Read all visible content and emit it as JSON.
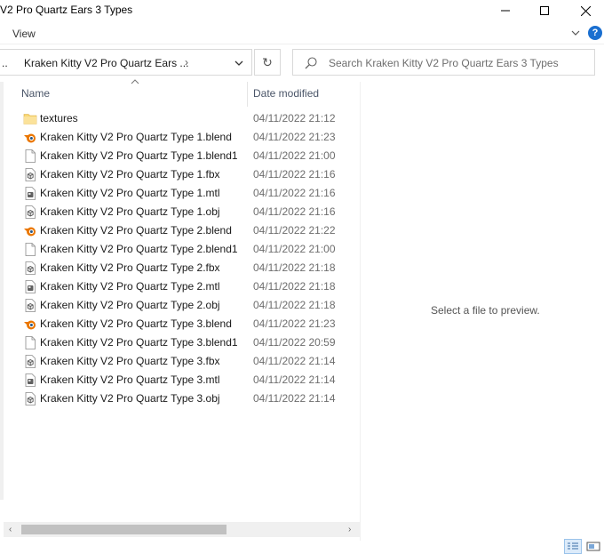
{
  "window": {
    "title": "V2 Pro Quartz Ears 3 Types"
  },
  "ribbon": {
    "view_label": "View",
    "help_label": "?"
  },
  "address": {
    "ellipsis": "..",
    "path": "Kraken Kitty V2 Pro Quartz Ears ...",
    "separator": "›"
  },
  "search": {
    "placeholder": "Search Kraken Kitty V2 Pro Quartz Ears 3 Types"
  },
  "columns": {
    "name": "Name",
    "date_modified": "Date modified"
  },
  "files": [
    {
      "name": "textures",
      "date": "04/11/2022 21:12",
      "icon": "folder-icon"
    },
    {
      "name": "Kraken Kitty V2 Pro Quartz Type 1.blend",
      "date": "04/11/2022 21:23",
      "icon": "blender-icon"
    },
    {
      "name": "Kraken Kitty V2 Pro Quartz Type 1.blend1",
      "date": "04/11/2022 21:00",
      "icon": "blank-file-icon"
    },
    {
      "name": "Kraken Kitty V2 Pro Quartz Type 1.fbx",
      "date": "04/11/2022 21:16",
      "icon": "3d-file-icon"
    },
    {
      "name": "Kraken Kitty V2 Pro Quartz Type 1.mtl",
      "date": "04/11/2022 21:16",
      "icon": "mtl-file-icon"
    },
    {
      "name": "Kraken Kitty V2 Pro Quartz Type 1.obj",
      "date": "04/11/2022 21:16",
      "icon": "3d-file-icon"
    },
    {
      "name": "Kraken Kitty V2 Pro Quartz Type 2.blend",
      "date": "04/11/2022 21:22",
      "icon": "blender-icon"
    },
    {
      "name": "Kraken Kitty V2 Pro Quartz Type 2.blend1",
      "date": "04/11/2022 21:00",
      "icon": "blank-file-icon"
    },
    {
      "name": "Kraken Kitty V2 Pro Quartz Type 2.fbx",
      "date": "04/11/2022 21:18",
      "icon": "3d-file-icon"
    },
    {
      "name": "Kraken Kitty V2 Pro Quartz Type 2.mtl",
      "date": "04/11/2022 21:18",
      "icon": "mtl-file-icon"
    },
    {
      "name": "Kraken Kitty V2 Pro Quartz Type 2.obj",
      "date": "04/11/2022 21:18",
      "icon": "3d-file-icon"
    },
    {
      "name": "Kraken Kitty V2 Pro Quartz Type 3.blend",
      "date": "04/11/2022 21:23",
      "icon": "blender-icon"
    },
    {
      "name": "Kraken Kitty V2 Pro Quartz Type 3.blend1",
      "date": "04/11/2022 20:59",
      "icon": "blank-file-icon"
    },
    {
      "name": "Kraken Kitty V2 Pro Quartz Type 3.fbx",
      "date": "04/11/2022 21:14",
      "icon": "3d-file-icon"
    },
    {
      "name": "Kraken Kitty V2 Pro Quartz Type 3.mtl",
      "date": "04/11/2022 21:14",
      "icon": "mtl-file-icon"
    },
    {
      "name": "Kraken Kitty V2 Pro Quartz Type 3.obj",
      "date": "04/11/2022 21:14",
      "icon": "3d-file-icon"
    }
  ],
  "preview": {
    "message": "Select a file to preview."
  },
  "colors": {
    "folder": "#f8d775",
    "blender_orange": "#ea7600",
    "blender_blue": "#265787",
    "accent": "#1a6fd0"
  }
}
